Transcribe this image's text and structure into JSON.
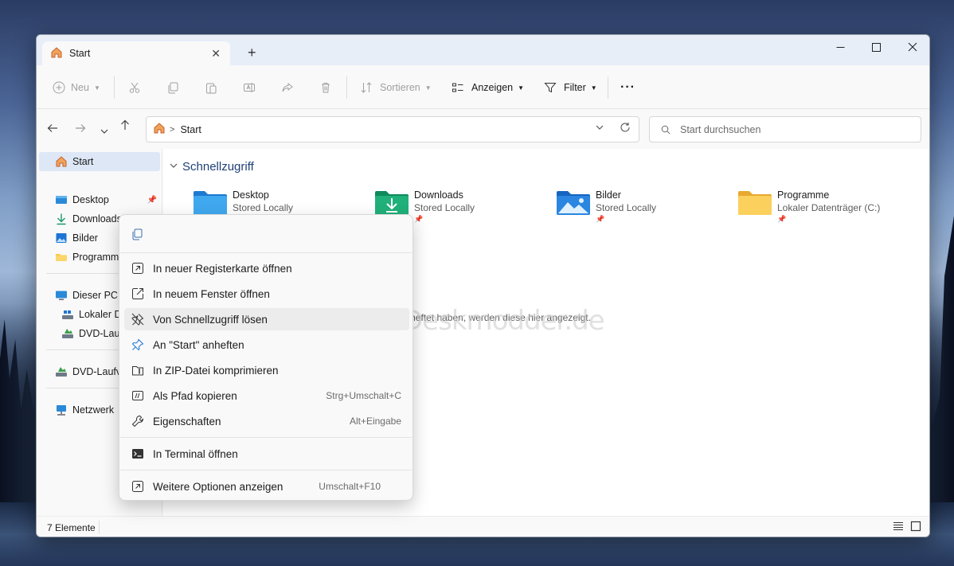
{
  "window": {
    "tab_title": "Start",
    "colors": {
      "accent": "#0067c0",
      "folder_yellow": "#f8c948",
      "selected_bg": "#dde7f6"
    }
  },
  "toolbar": {
    "new_label": "Neu",
    "sort_label": "Sortieren",
    "view_label": "Anzeigen",
    "filter_label": "Filter",
    "more_label": "···"
  },
  "address": {
    "crumb": "Start",
    "search_placeholder": "Start durchsuchen"
  },
  "sidebar": {
    "items": [
      {
        "label": "Start",
        "icon": "home-icon",
        "pinned": false
      },
      {
        "label": "Desktop",
        "icon": "desktop-folder-icon",
        "pinned": true
      },
      {
        "label": "Downloads",
        "icon": "download-icon",
        "pinned": true
      },
      {
        "label": "Bilder",
        "icon": "pictures-icon",
        "pinned": true
      },
      {
        "label": "Programme",
        "icon": "folder-icon",
        "pinned": true
      },
      {
        "label": "Dieser PC",
        "icon": "pc-icon",
        "pinned": false
      },
      {
        "label": "Lokaler D",
        "icon": "drive-icon",
        "pinned": false
      },
      {
        "label": "DVD-Lauf",
        "icon": "dvd-icon",
        "pinned": false
      },
      {
        "label": "DVD-Laufv",
        "icon": "dvd-icon",
        "pinned": false
      },
      {
        "label": "Netzwerk",
        "icon": "network-icon",
        "pinned": false
      }
    ]
  },
  "main": {
    "section_title": "Schnellzugriff",
    "quick_access": [
      {
        "name": "Desktop",
        "sub": "Stored Locally",
        "icon": "desktop-folder-icon"
      },
      {
        "name": "Downloads",
        "sub": "Stored Locally",
        "icon": "downloads-folder-icon"
      },
      {
        "name": "Bilder",
        "sub": "Stored Locally",
        "icon": "pictures-folder-icon"
      },
      {
        "name": "Programme",
        "sub": "Lokaler Datenträger (C:)",
        "icon": "folder-icon"
      }
    ],
    "empty_message": "lem Sie einige Dateien angeheftet haben, werden diese hier angezeigt.",
    "watermark": "Deskmodder.de"
  },
  "context_menu": {
    "items": [
      {
        "label": "In neuer Registerkarte öffnen",
        "shortcut": "",
        "icon": "open-new-tab-icon"
      },
      {
        "label": "In neuem Fenster öffnen",
        "shortcut": "",
        "icon": "open-new-window-icon"
      },
      {
        "label": "Von Schnellzugriff lösen",
        "shortcut": "",
        "icon": "unpin-icon"
      },
      {
        "label": "An \"Start\" anheften",
        "shortcut": "",
        "icon": "pin-icon"
      },
      {
        "label": "In ZIP-Datei komprimieren",
        "shortcut": "",
        "icon": "zip-icon"
      },
      {
        "label": "Als Pfad kopieren",
        "shortcut": "Strg+Umschalt+C",
        "icon": "copy-path-icon"
      },
      {
        "label": "Eigenschaften",
        "shortcut": "Alt+Eingabe",
        "icon": "wrench-icon"
      },
      {
        "label": "In Terminal öffnen",
        "shortcut": "",
        "icon": "terminal-icon"
      },
      {
        "label": "Weitere Optionen anzeigen",
        "shortcut": "Umschalt+F10",
        "icon": "more-options-icon"
      }
    ]
  },
  "status": {
    "count": "7 Elemente"
  }
}
